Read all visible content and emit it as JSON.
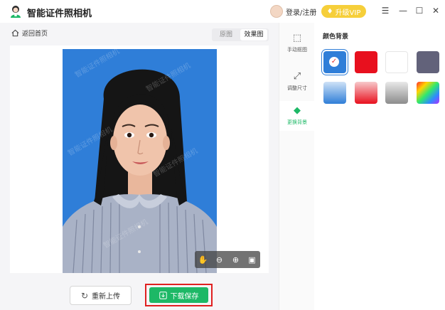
{
  "app": {
    "title": "智能证件照相机"
  },
  "header": {
    "login_label": "登录/注册",
    "vip_label": "升级VIP"
  },
  "toolbar": {
    "back_label": "返回首页",
    "tabs": [
      "原图",
      "效果图"
    ],
    "active_tab": "效果图"
  },
  "tools": [
    {
      "label": "手动抠图",
      "icon": "crop-select-icon"
    },
    {
      "label": "调整尺寸",
      "icon": "resize-icon"
    },
    {
      "label": "更换背景",
      "icon": "paint-bucket-icon",
      "active": true
    }
  ],
  "panel": {
    "title": "颜色背景",
    "swatches": [
      {
        "name": "blue",
        "color": "#2f7ed8",
        "selected": true
      },
      {
        "name": "red",
        "color": "#e8101e"
      },
      {
        "name": "white",
        "color": "#ffffff"
      },
      {
        "name": "gray-blue",
        "color": "#62627a"
      },
      {
        "name": "blue-gradient",
        "color": "#6fa8ef"
      },
      {
        "name": "red-gradient",
        "color": "#e8323c"
      },
      {
        "name": "gray-gradient",
        "color": "#a9a9a9"
      },
      {
        "name": "rainbow",
        "color": "#ff00ff"
      }
    ]
  },
  "zoom_controls": [
    "hand-icon",
    "zoom-out-icon",
    "zoom-in-icon",
    "fit-icon"
  ],
  "actions": {
    "reupload_label": "重新上传",
    "download_label": "下载保存"
  },
  "photo": {
    "watermark": "智能证件照相机"
  }
}
